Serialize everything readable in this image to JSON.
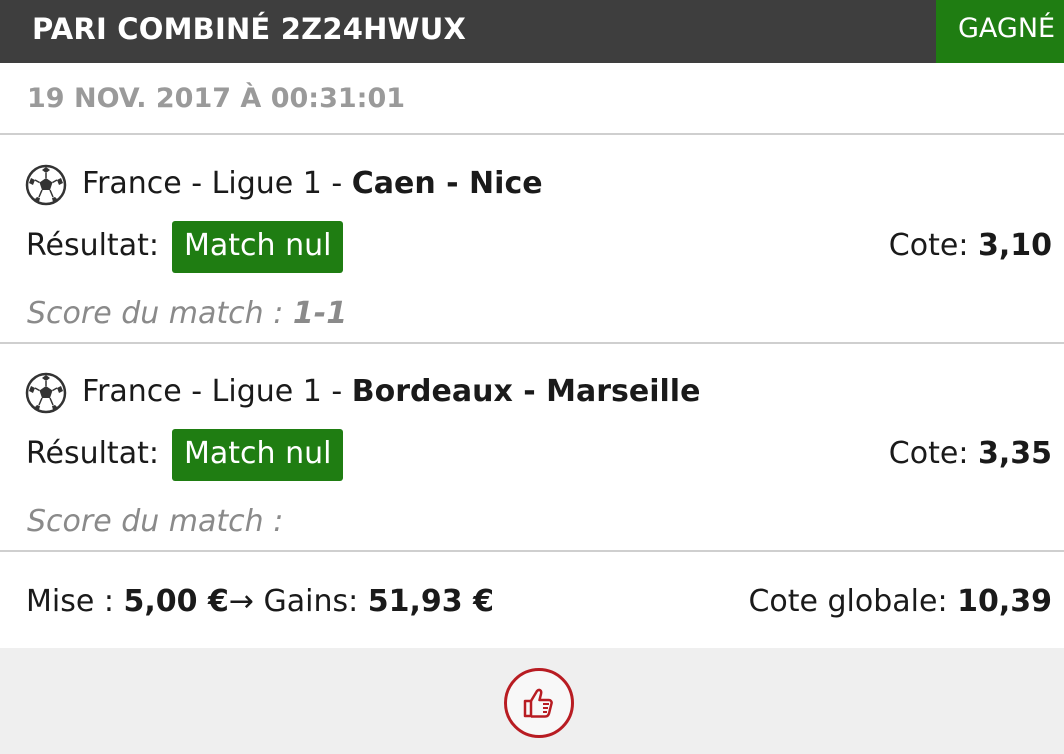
{
  "header": {
    "title": "PARI COMBINÉ 2Z24HWUX",
    "status": "GAGNÉ"
  },
  "date": "19 NOV. 2017 À 00:31:01",
  "selections": [
    {
      "icon": "soccer-ball-icon",
      "league": "France - Ligue 1 - ",
      "teams": "Caen - Nice",
      "result_label": "Résultat:",
      "result_value": "Match nul",
      "odds_label": "Cote: ",
      "odds_value": "3,10",
      "score_label": "Score du match : ",
      "score_value": "1-1"
    },
    {
      "icon": "soccer-ball-icon",
      "league": "France - Ligue 1 - ",
      "teams": "Bordeaux - Marseille",
      "result_label": "Résultat:",
      "result_value": "Match nul",
      "odds_label": "Cote: ",
      "odds_value": "3,35",
      "score_label": "Score du match :",
      "score_value": ""
    }
  ],
  "footer": {
    "stake_label": "Mise : ",
    "stake_value": "5,00 €",
    "arrow": "→",
    "gains_label": " Gains: ",
    "gains_value": "51,93 €",
    "total_odds_label": "Cote globale: ",
    "total_odds_value": "10,39"
  },
  "actions": {
    "like_icon": "thumbs-up-icon"
  },
  "colors": {
    "header_bg": "#3e3e3e",
    "win_green": "#1f7d12",
    "like_red": "#b81c22"
  }
}
